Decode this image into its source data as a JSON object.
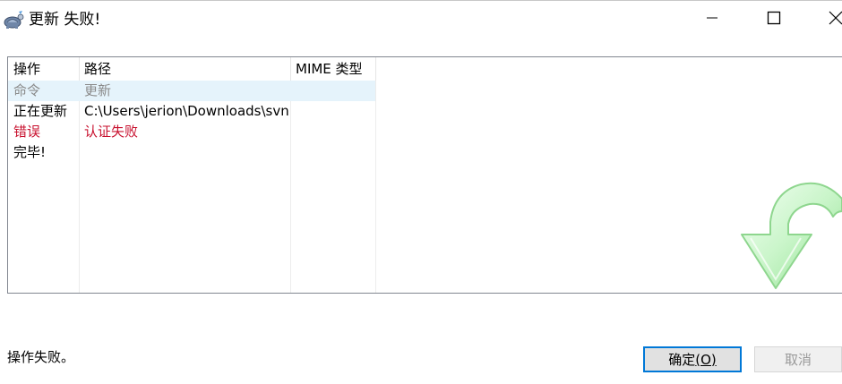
{
  "window": {
    "title": "更新 失败!"
  },
  "list": {
    "columns": [
      "操作",
      "路径",
      "MIME 类型"
    ],
    "rows": [
      {
        "action": "命令",
        "path": "更新",
        "mime": "",
        "style": "gray",
        "selected": true
      },
      {
        "action": "正在更新",
        "path": "C:\\Users\\jerion\\Downloads\\svn",
        "mime": "",
        "style": "normal",
        "selected": false
      },
      {
        "action": "错误",
        "path": "认证失败",
        "mime": "",
        "style": "red",
        "selected": false
      },
      {
        "action": "完毕!",
        "path": "",
        "mime": "",
        "style": "normal",
        "selected": false
      }
    ]
  },
  "status": {
    "text": "操作失败。"
  },
  "buttons": {
    "ok_label": "确定",
    "ok_mnemonic": "(O)",
    "cancel_label": "取消"
  },
  "colors": {
    "selected_row_bg": "#e5f3fb",
    "error_text": "#c8102e",
    "muted_text": "#8a8a8a",
    "default_button_border": "#0078d7"
  },
  "icons": {
    "app": "tortoise-icon",
    "minimize": "minimize-icon",
    "maximize": "maximize-icon",
    "close": "close-icon",
    "update_arrow": "update-arrow-icon"
  }
}
